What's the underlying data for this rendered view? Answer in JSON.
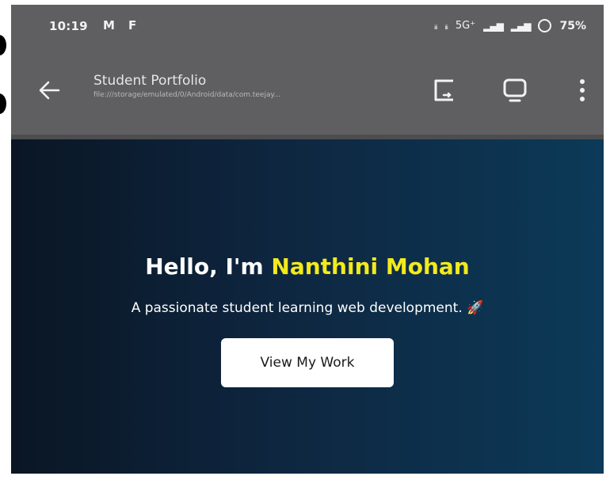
{
  "status_bar": {
    "time": "10:19",
    "left_glyph_1": "M",
    "left_glyph_2": "F",
    "network_1": "5G",
    "network_2": "5G⁺",
    "battery_percent": "75%"
  },
  "app_bar": {
    "title": "Student Portfolio",
    "url": "file:///storage/emulated/0/Android/data/com.teejay..."
  },
  "hero": {
    "greeting": "Hello, I'm ",
    "name": "Nanthini Mohan",
    "tagline": "A passionate student learning web development. 🚀",
    "button_label": "View My Work"
  },
  "colors": {
    "accent_name": "#f3ea1c",
    "toolbar_bg": "#5f5f61"
  },
  "icons": {
    "back": "arrow-left-icon",
    "open_external": "open-in-browser-icon",
    "desktop": "desktop-view-icon",
    "more": "more-vertical-icon"
  }
}
